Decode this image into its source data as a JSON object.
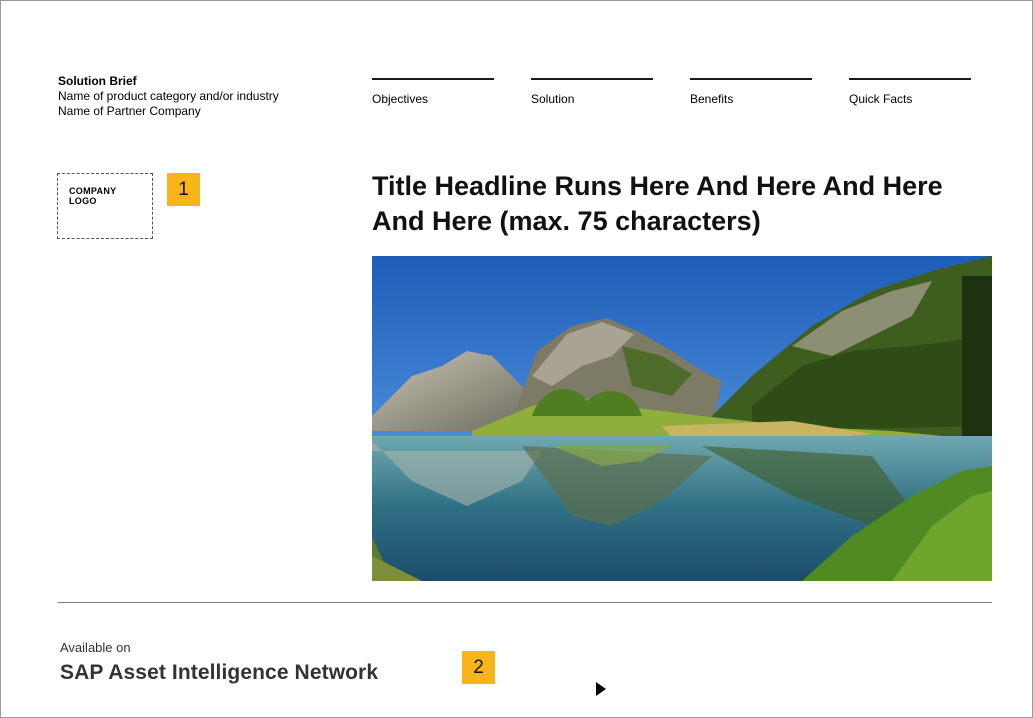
{
  "brief": {
    "title": "Solution Brief",
    "line1": "Name of product category and/or industry",
    "line2": "Name of Partner Company"
  },
  "nav": {
    "items": [
      {
        "label": "Objectives"
      },
      {
        "label": "Solution"
      },
      {
        "label": "Benefits"
      },
      {
        "label": "Quick Facts"
      }
    ]
  },
  "logo": {
    "line1": "COMPANY",
    "line2": "LOGO"
  },
  "markers": {
    "first": "1",
    "second": "2"
  },
  "headline": {
    "text": "Title Headline Runs Here And Here And Here And Here (max. 75 characters)"
  },
  "hero": {
    "description_icon": "landscape-photo"
  },
  "footer": {
    "available_label": "Available on",
    "network_name": "SAP Asset Intelligence Network",
    "play_icon": "play-icon"
  },
  "colors": {
    "marker": "#f7b51a",
    "divider": "#777777"
  }
}
